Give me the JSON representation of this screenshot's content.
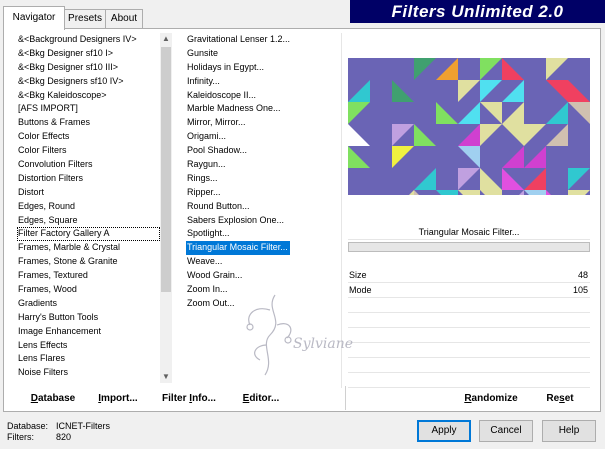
{
  "tabs": [
    {
      "label": "Navigator",
      "active": true
    },
    {
      "label": "Presets",
      "active": false
    },
    {
      "label": "About",
      "active": false
    }
  ],
  "banner": {
    "title": "Filters Unlimited 2.0"
  },
  "categories": {
    "items": [
      "&<Background Designers IV>",
      "&<Bkg Designer sf10 I>",
      "&<Bkg Designer sf10 III>",
      "&<Bkg Designers sf10 IV>",
      "&<Bkg Kaleidoscope>",
      "[AFS IMPORT]",
      "Buttons & Frames",
      "Color Effects",
      "Color Filters",
      "Convolution Filters",
      "Distortion Filters",
      "Distort",
      "Edges, Round",
      "Edges, Square",
      "Filter Factory Gallery A",
      "Frames, Marble & Crystal",
      "Frames, Stone & Granite",
      "Frames, Textured",
      "Frames, Wood",
      "Gradients",
      "Harry's Button Tools",
      "Image Enhancement",
      "Lens Effects",
      "Lens Flares",
      "Noise Filters"
    ],
    "highlighted_index": 14
  },
  "filters": {
    "items": [
      "Gravitational Lenser 1.2...",
      "Gunsite",
      "Holidays in Egypt...",
      "Infinity...",
      "Kaleidoscope II...",
      "Marble Madness One...",
      "Mirror, Mirror...",
      "Origami...",
      "Pool Shadow...",
      "Raygun...",
      "Rings...",
      "Ripper...",
      "Round Button...",
      "Sabers Explosion One...",
      "Spotlight...",
      "Triangular Mosaic Filter...",
      "Weave...",
      "Wood Grain...",
      "Zoom In...",
      "Zoom Out..."
    ],
    "selected_index": 15
  },
  "preview": {
    "colors": {
      "background": "#6a64b5",
      "palette": [
        "#d040d0",
        "#30c8d0",
        "#f0f040",
        "#f04060",
        "#50e0f0",
        "#c0a0e0",
        "#e0e0a0",
        "#40a070",
        "#f0a030",
        "#80e060",
        "#ffffff",
        "#a0d0f0",
        "#d0c0b0",
        "#e050e0"
      ]
    }
  },
  "filter_name": "Triangular Mosaic Filter...",
  "params": [
    {
      "label": "Size",
      "value": "48"
    },
    {
      "label": "Mode",
      "value": "105"
    }
  ],
  "toolbar": {
    "database": {
      "pre": "",
      "ul": "D",
      "post": "atabase"
    },
    "import": {
      "pre": "",
      "ul": "I",
      "post": "mport..."
    },
    "filter_info": {
      "pre": "Filter ",
      "ul": "I",
      "post": "nfo..."
    },
    "editor": {
      "pre": "",
      "ul": "E",
      "post": "ditor..."
    },
    "randomize": {
      "pre": "",
      "ul": "R",
      "post": "andomize"
    },
    "reset": {
      "pre": "Re",
      "ul": "s",
      "post": "et"
    }
  },
  "watermark": {
    "text": "Sylviane"
  },
  "info": {
    "database_label": "Database:",
    "database_value": "ICNET-Filters",
    "filters_label": "Filters:",
    "filters_value": "820"
  },
  "buttons": {
    "apply": "Apply",
    "cancel": "Cancel",
    "help": "Help"
  }
}
